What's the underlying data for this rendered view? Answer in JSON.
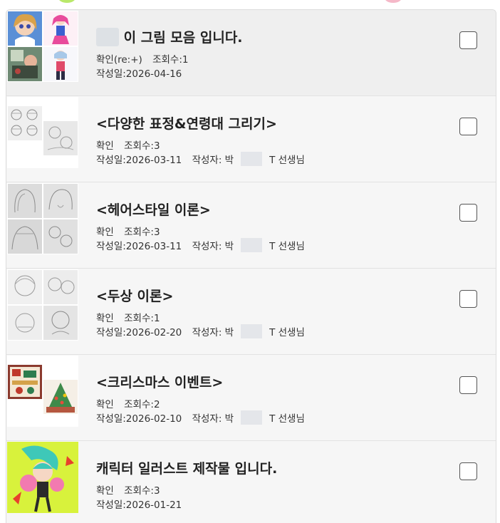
{
  "posts": [
    {
      "title": "이 그림 모음 입니다.",
      "status": "확인(re:+)",
      "views": "조회수:1",
      "date": "작성일:2026-04-16",
      "author_label": "",
      "author_suffix": ""
    },
    {
      "title": "<다양한 표정&연령대 그리기>",
      "status": "확인",
      "views": "조회수:3",
      "date": "작성일:2026-03-11",
      "author_label": "작성자: 박",
      "author_suffix": "T 선생님"
    },
    {
      "title": "<헤어스타일 이론>",
      "status": "확인",
      "views": "조회수:3",
      "date": "작성일:2026-03-11",
      "author_label": "작성자: 박",
      "author_suffix": "T 선생님"
    },
    {
      "title": "<두상 이론>",
      "status": "확인",
      "views": "조회수:1",
      "date": "작성일:2026-02-20",
      "author_label": "작성자: 박",
      "author_suffix": "T 선생님"
    },
    {
      "title": "<크리스마스 이벤트>",
      "status": "확인",
      "views": "조회수:2",
      "date": "작성일:2026-02-10",
      "author_label": "작성자: 박",
      "author_suffix": "T 선생님"
    },
    {
      "title": "캐릭터 일러스트 제작물 입니다.",
      "status": "확인",
      "views": "조회수:3",
      "date": "작성일:2026-01-21",
      "author_label": "",
      "author_suffix": ""
    }
  ],
  "colors": {
    "list_bg": "#f6f6f6",
    "first_item_bg": "#efefef",
    "border": "#dcdcdc",
    "text": "#222222"
  },
  "icons": {
    "checkbox": "checkbox-icon"
  }
}
